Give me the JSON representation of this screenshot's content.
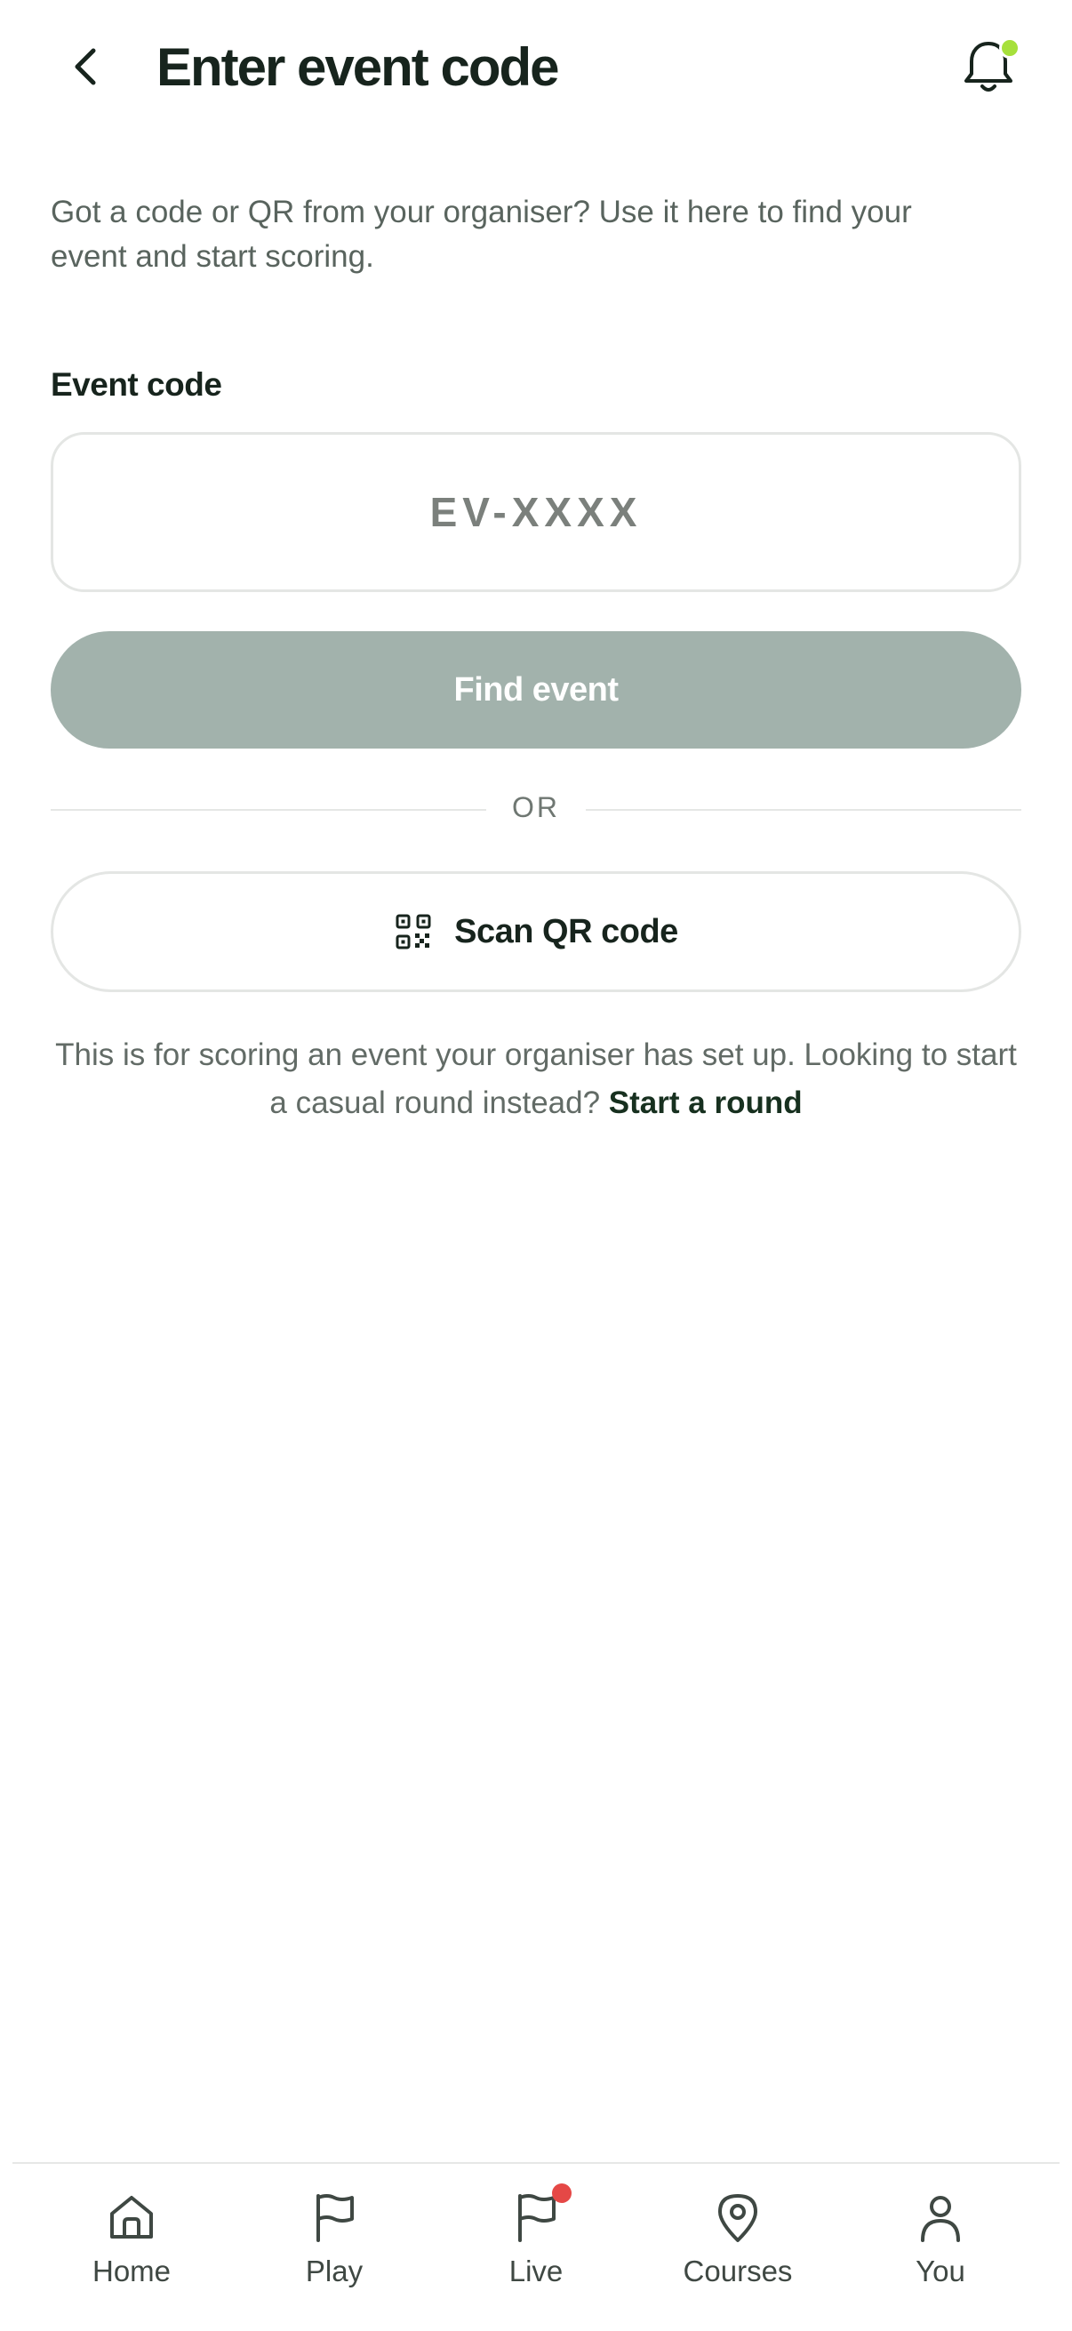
{
  "header": {
    "title": "Enter event code",
    "back_icon": "chevron-left-icon",
    "bell_icon": "bell-icon",
    "bell_dot_color": "#a6e03b"
  },
  "intro": {
    "text": "Got a code or QR from your organiser? Use it here to find your event and start scoring."
  },
  "event_code": {
    "label": "Event code",
    "value": "",
    "placeholder": "EV-XXXX"
  },
  "find_button": {
    "label": "Find event",
    "color": "#a2b2ac"
  },
  "divider": {
    "text": "OR"
  },
  "scan_button": {
    "label": "Scan QR code",
    "icon": "qr-code-icon"
  },
  "footnote": {
    "text": "This is for scoring an event your organiser has set up. Looking to start a casual round instead?",
    "link": "Start a round"
  },
  "tabbar": {
    "items": [
      {
        "label": "Home",
        "icon": "home-icon"
      },
      {
        "label": "Play",
        "icon": "flag-icon"
      },
      {
        "label": "Live",
        "icon": "flag-icon",
        "badge_color": "#e54846"
      },
      {
        "label": "Courses",
        "icon": "map-pin-icon"
      },
      {
        "label": "You",
        "icon": "user-icon"
      }
    ]
  }
}
